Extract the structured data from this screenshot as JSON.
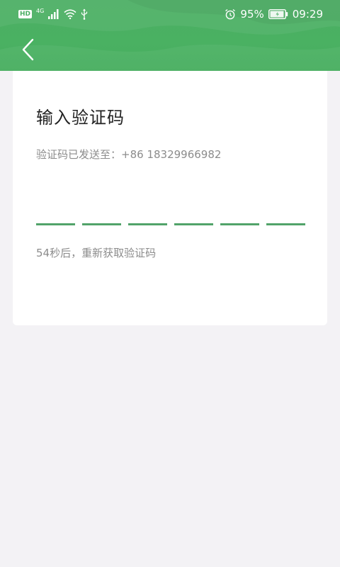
{
  "status_bar": {
    "hd": "HD",
    "network": "4G",
    "battery_percent": "95%",
    "time": "09:29",
    "battery_level": 0.95
  },
  "header": {
    "back_icon": "chevron-left-icon"
  },
  "verify": {
    "title": "输入验证码",
    "sent_to_label": "验证码已发送至：",
    "phone": "+86 18329966982",
    "countdown_text": "54秒后，重新获取验证码",
    "code_slots": [
      "",
      "",
      "",
      "",
      "",
      ""
    ]
  },
  "colors": {
    "accent": "#4caf64",
    "underline": "#52a36a",
    "background": "#f3f2f5"
  }
}
